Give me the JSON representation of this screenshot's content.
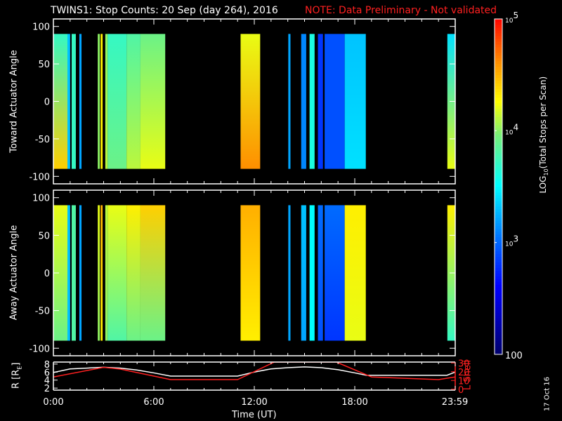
{
  "title": "TWINS1: Stop Counts: 20 Sep (day 264), 2016",
  "note": "NOTE: Data Preliminary - Not validated",
  "date_stamp": "17 Oct 16",
  "chart_data": [
    {
      "type": "heatmap",
      "name": "toward",
      "ylabel": "Toward Actuator Angle",
      "ylim": [
        -110,
        110
      ],
      "yticks": [
        "100",
        "50",
        "0",
        "-50",
        "-100"
      ],
      "ytick_values": [
        100,
        50,
        0,
        -50,
        -100
      ],
      "xlim_hours": [
        0,
        24
      ],
      "segments_log10": [
        [
          0,
          0.84,
          3.7,
          4.4
        ],
        [
          0.84,
          1.0,
          3.3,
          3.3
        ],
        [
          1.09,
          1.34,
          3.7,
          3.7
        ],
        [
          1.55,
          1.68,
          3.2,
          3.2
        ],
        [
          2.65,
          2.77,
          4.0,
          4.0
        ],
        [
          2.82,
          2.94,
          4.3,
          4.3
        ],
        [
          3.1,
          3.24,
          4.0,
          4.1
        ],
        [
          3.24,
          4.37,
          3.7,
          3.9
        ],
        [
          4.37,
          5.2,
          3.8,
          4.1
        ],
        [
          5.2,
          6.68,
          3.9,
          4.2
        ],
        [
          11.18,
          12.35,
          4.2,
          4.6
        ],
        [
          14.03,
          14.16,
          3.2,
          3.2
        ],
        [
          14.8,
          15.1,
          3.1,
          3.1
        ],
        [
          15.3,
          15.6,
          3.6,
          3.6
        ],
        [
          15.8,
          16.1,
          2.8,
          2.8
        ],
        [
          16.2,
          17.4,
          2.9,
          2.9
        ],
        [
          17.4,
          18.66,
          3.3,
          3.4
        ],
        [
          23.53,
          24,
          3.4,
          4.2
        ]
      ]
    },
    {
      "type": "heatmap",
      "name": "away",
      "ylabel": "Away Actuator Angle",
      "ylim": [
        -110,
        110
      ],
      "yticks": [
        "100",
        "50",
        "0",
        "-50",
        "-100"
      ],
      "ytick_values": [
        100,
        50,
        0,
        -50,
        -100
      ],
      "xlim_hours": [
        0,
        24
      ],
      "segments_log10": [
        [
          0,
          0.84,
          4.2,
          3.9
        ],
        [
          0.84,
          1.0,
          3.3,
          3.3
        ],
        [
          1.09,
          1.34,
          3.8,
          3.8
        ],
        [
          1.55,
          1.68,
          3.2,
          3.2
        ],
        [
          2.65,
          2.77,
          4.2,
          4.0
        ],
        [
          2.82,
          2.94,
          4.5,
          4.3
        ],
        [
          3.1,
          3.24,
          4.1,
          4.0
        ],
        [
          3.24,
          4.37,
          4.2,
          3.8
        ],
        [
          4.37,
          5.2,
          4.3,
          3.9
        ],
        [
          5.2,
          6.68,
          4.4,
          3.9
        ],
        [
          11.18,
          12.35,
          4.5,
          4.3
        ],
        [
          14.03,
          14.16,
          3.2,
          3.2
        ],
        [
          14.8,
          15.1,
          3.3,
          3.2
        ],
        [
          15.3,
          15.6,
          3.5,
          3.5
        ],
        [
          15.8,
          16.1,
          3.0,
          2.9
        ],
        [
          16.2,
          17.4,
          3.0,
          2.8
        ],
        [
          17.4,
          18.66,
          4.3,
          4.2
        ],
        [
          23.53,
          24,
          4.3,
          3.7
        ]
      ]
    },
    {
      "type": "line",
      "name": "orbit",
      "ylabel": "R [R",
      "ylabel_sub": "E",
      "ylabel_end": "]",
      "ylim": [
        1.5,
        8.5
      ],
      "yticks": [
        "8",
        "6",
        "4",
        "2"
      ],
      "ytick_values": [
        8,
        6,
        4,
        2
      ],
      "y2label": "L Shell",
      "y2lim": [
        -1,
        31
      ],
      "y2ticks": [
        "30",
        "20",
        "10",
        "0"
      ],
      "y2tick_values": [
        30,
        20,
        10,
        0
      ],
      "xlabel": "Time (UT)",
      "xticks": [
        "0:00",
        "6:00",
        "12:00",
        "18:00",
        "23:59"
      ],
      "xtick_values": [
        0,
        6,
        12,
        18,
        23.98
      ],
      "series": [
        {
          "name": "R",
          "color": "#ffffff",
          "x": [
            0,
            1,
            2,
            3,
            4,
            5,
            6,
            7,
            11,
            12,
            13,
            14,
            15,
            16,
            17,
            18,
            18.7,
            23.5,
            24
          ],
          "y": [
            5.9,
            6.8,
            7.0,
            7.2,
            7.0,
            6.5,
            5.8,
            5.0,
            5.0,
            6.0,
            6.8,
            7.1,
            7.3,
            7.1,
            6.6,
            5.8,
            5.2,
            5.2,
            6.0
          ]
        },
        {
          "name": "L Shell",
          "color": "#ff2020",
          "x": [
            0,
            3,
            4,
            7,
            11,
            13.2,
            16.9,
            19,
            23,
            24
          ],
          "y": [
            14,
            25,
            23,
            11,
            11,
            31,
            31,
            14,
            11,
            14
          ]
        }
      ]
    }
  ],
  "colorbar": {
    "label": "LOG",
    "label_sub": "10",
    "label_rest": "(Total Stops per Scan)",
    "ticks": [
      {
        "base": "10",
        "exp": "5",
        "value": 5
      },
      {
        "base": "10",
        "exp": "4",
        "value": 4
      },
      {
        "base": "10",
        "exp": "3",
        "value": 3
      },
      {
        "base": "100",
        "exp": "",
        "value": 2
      }
    ],
    "range_log10": [
      2,
      5
    ]
  }
}
